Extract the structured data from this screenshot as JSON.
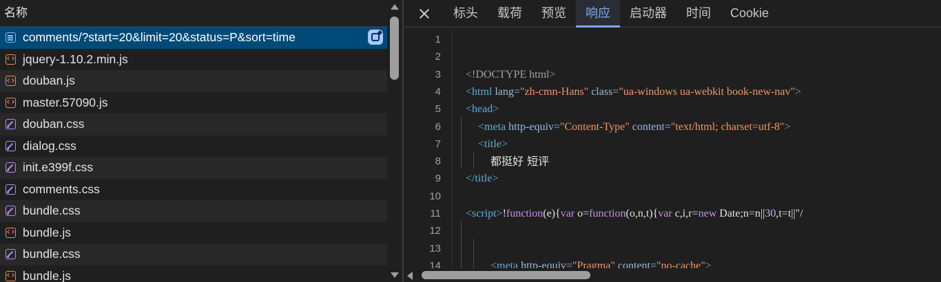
{
  "request_list": {
    "header": "名称",
    "items": [
      {
        "name": "comments/?start=20&limit=20&status=P&sort=time",
        "type": "doc",
        "selected": true
      },
      {
        "name": "jquery-1.10.2.min.js",
        "type": "js"
      },
      {
        "name": "douban.js",
        "type": "js"
      },
      {
        "name": "master.57090.js",
        "type": "js"
      },
      {
        "name": "douban.css",
        "type": "css"
      },
      {
        "name": "dialog.css",
        "type": "css"
      },
      {
        "name": "init.e399f.css",
        "type": "css"
      },
      {
        "name": "comments.css",
        "type": "css"
      },
      {
        "name": "bundle.css",
        "type": "css"
      },
      {
        "name": "bundle.js",
        "type": "js"
      },
      {
        "name": "bundle.css",
        "type": "css"
      },
      {
        "name": "bundle.js",
        "type": "js"
      }
    ]
  },
  "detail_tabs": {
    "items": [
      "标头",
      "载荷",
      "预览",
      "响应",
      "启动器",
      "时间",
      "Cookie"
    ],
    "active": "响应"
  },
  "response": {
    "line_numbers": [
      "1",
      "2",
      "3",
      "4",
      "5",
      "6",
      "7",
      "8",
      "9",
      "10",
      "11",
      "12",
      "13",
      "14"
    ],
    "doctype": "<!DOCTYPE html>",
    "html_open": {
      "tag": "<html",
      "attr1": " lang=",
      "val1": "\"zh-cmn-Hans\"",
      "attr2": " class=",
      "val2": "\"ua-windows ua-webkit book-new-nav\"",
      "close": ">"
    },
    "head_open": "<head>",
    "meta_line": {
      "tag": "<meta",
      "attr1": " http-equiv=",
      "val1": "\"Content-Type\"",
      "attr2": " content=",
      "val2": "\"text/html; charset=utf-8\"",
      "close": ">"
    },
    "title_open": "<title>",
    "title_text": "都挺好 短评",
    "title_close": "</title>",
    "script_line": {
      "tag": "<script>",
      "p1": "!",
      "kw1": "function",
      "p2": "(e){",
      "kw2": "var",
      "p3": " o=",
      "kw3": "function",
      "p4": "(o,n,t){",
      "kw4": "var",
      "p5": " c,i,r=",
      "kw5": "new",
      "p6": " Date;n=n||",
      "n1": "30",
      "p7": ",t=t||\"/"
    },
    "meta2_line": {
      "tag": "<meta",
      "attr1": " http-equiv=",
      "val1": "\"Pragma\"",
      "attr2": " content=",
      "val2": "\"no-cache\"",
      "close": ">"
    }
  }
}
